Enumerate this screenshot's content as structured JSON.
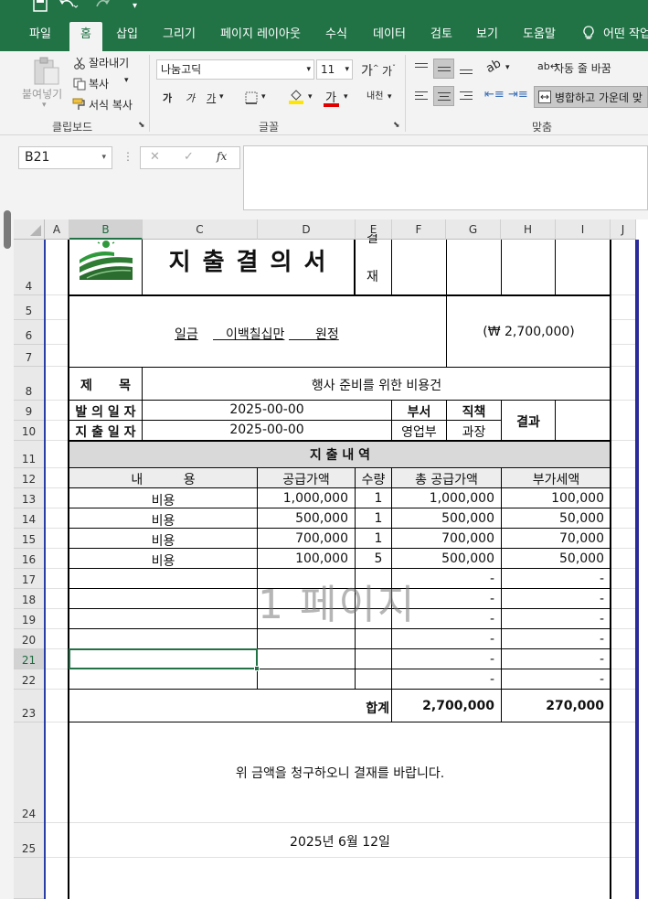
{
  "quick_access": {
    "save_icon": "save-icon",
    "undo_icon": "undo-icon",
    "redo_icon": "redo-icon",
    "more_icon": "customize-icon"
  },
  "tabs": [
    "파일",
    "홈",
    "삽입",
    "그리기",
    "페이지 레이아웃",
    "수식",
    "데이터",
    "검토",
    "보기",
    "도움말",
    "어떤 작업"
  ],
  "active_tab": "홈",
  "ribbon": {
    "clipboard": {
      "paste": "붙여넣기",
      "cut": "잘라내기",
      "copy": "복사",
      "format_painter": "서식 복사",
      "group": "클립보드"
    },
    "font": {
      "name": "나눔고딕",
      "size": "11",
      "grow": "가",
      "shrink": "가",
      "bold": "가",
      "italic": "가",
      "underline": "가",
      "color_letter": "가",
      "phonetic": "내천",
      "group": "글꼴"
    },
    "alignment": {
      "wrap": "자동 줄 바꿈",
      "merge": "병합하고 가운데 맞",
      "group": "맞춤"
    }
  },
  "formula_bar": {
    "name_box": "B21",
    "cancel": "✕",
    "enter": "✓",
    "fx": "fx",
    "value": ""
  },
  "columns": [
    "A",
    "B",
    "C",
    "D",
    "E",
    "F",
    "G",
    "H",
    "I",
    "J"
  ],
  "rows": [
    "4",
    "5",
    "6",
    "7",
    "8",
    "9",
    "10",
    "11",
    "12",
    "13",
    "14",
    "15",
    "16",
    "17",
    "18",
    "19",
    "20",
    "21",
    "22",
    "23",
    "24",
    "25"
  ],
  "selected_cell": "B21",
  "doc": {
    "title": "지 출 결 의 서",
    "approval_a": "결",
    "approval_b": "재",
    "amount_korean_prefix": "일금",
    "amount_korean": "이백칠십만",
    "amount_korean_suffix": "원정",
    "amount_number": "(₩ 2,700,000)",
    "subject_label": "제      목",
    "subject_value": "행사 준비를 위한 비용건",
    "request_date_label": "발 의 일 자",
    "request_date": "2025-00-00",
    "pay_date_label": "지 출 일 자",
    "pay_date": "2025-00-00",
    "dept_label": "부서",
    "dept_value": "영업부",
    "position_label": "직책",
    "position_value": "과장",
    "result_label": "결과",
    "details_title": "지 출 내 역",
    "headers": [
      "내          용",
      "공급가액",
      "수량",
      "총 공급가액",
      "부가세액"
    ],
    "items": [
      {
        "desc": "비용",
        "price": "1,000,000",
        "qty": "1",
        "total": "1,000,000",
        "vat": "100,000"
      },
      {
        "desc": "비용",
        "price": "500,000",
        "qty": "1",
        "total": "500,000",
        "vat": "50,000"
      },
      {
        "desc": "비용",
        "price": "700,000",
        "qty": "1",
        "total": "700,000",
        "vat": "70,000"
      },
      {
        "desc": "비용",
        "price": "100,000",
        "qty": "5",
        "total": "500,000",
        "vat": "50,000"
      },
      {
        "desc": "",
        "price": "",
        "qty": "",
        "total": "-",
        "vat": "-"
      },
      {
        "desc": "",
        "price": "",
        "qty": "",
        "total": "-",
        "vat": "-"
      },
      {
        "desc": "",
        "price": "",
        "qty": "",
        "total": "-",
        "vat": "-"
      },
      {
        "desc": "",
        "price": "",
        "qty": "",
        "total": "-",
        "vat": "-"
      },
      {
        "desc": "",
        "price": "",
        "qty": "",
        "total": "-",
        "vat": "-"
      },
      {
        "desc": "",
        "price": "",
        "qty": "",
        "total": "-",
        "vat": "-"
      }
    ],
    "sum_label": "합계",
    "sum_total": "2,700,000",
    "sum_vat": "270,000",
    "request_text": "위 금액을 청구하오니 결재를 바랍니다.",
    "date_text": "2025년 6월 12일"
  },
  "page_watermark": "1 페이지",
  "colors": {
    "excel_green": "#217346",
    "page_break": "#2a3ea8"
  }
}
